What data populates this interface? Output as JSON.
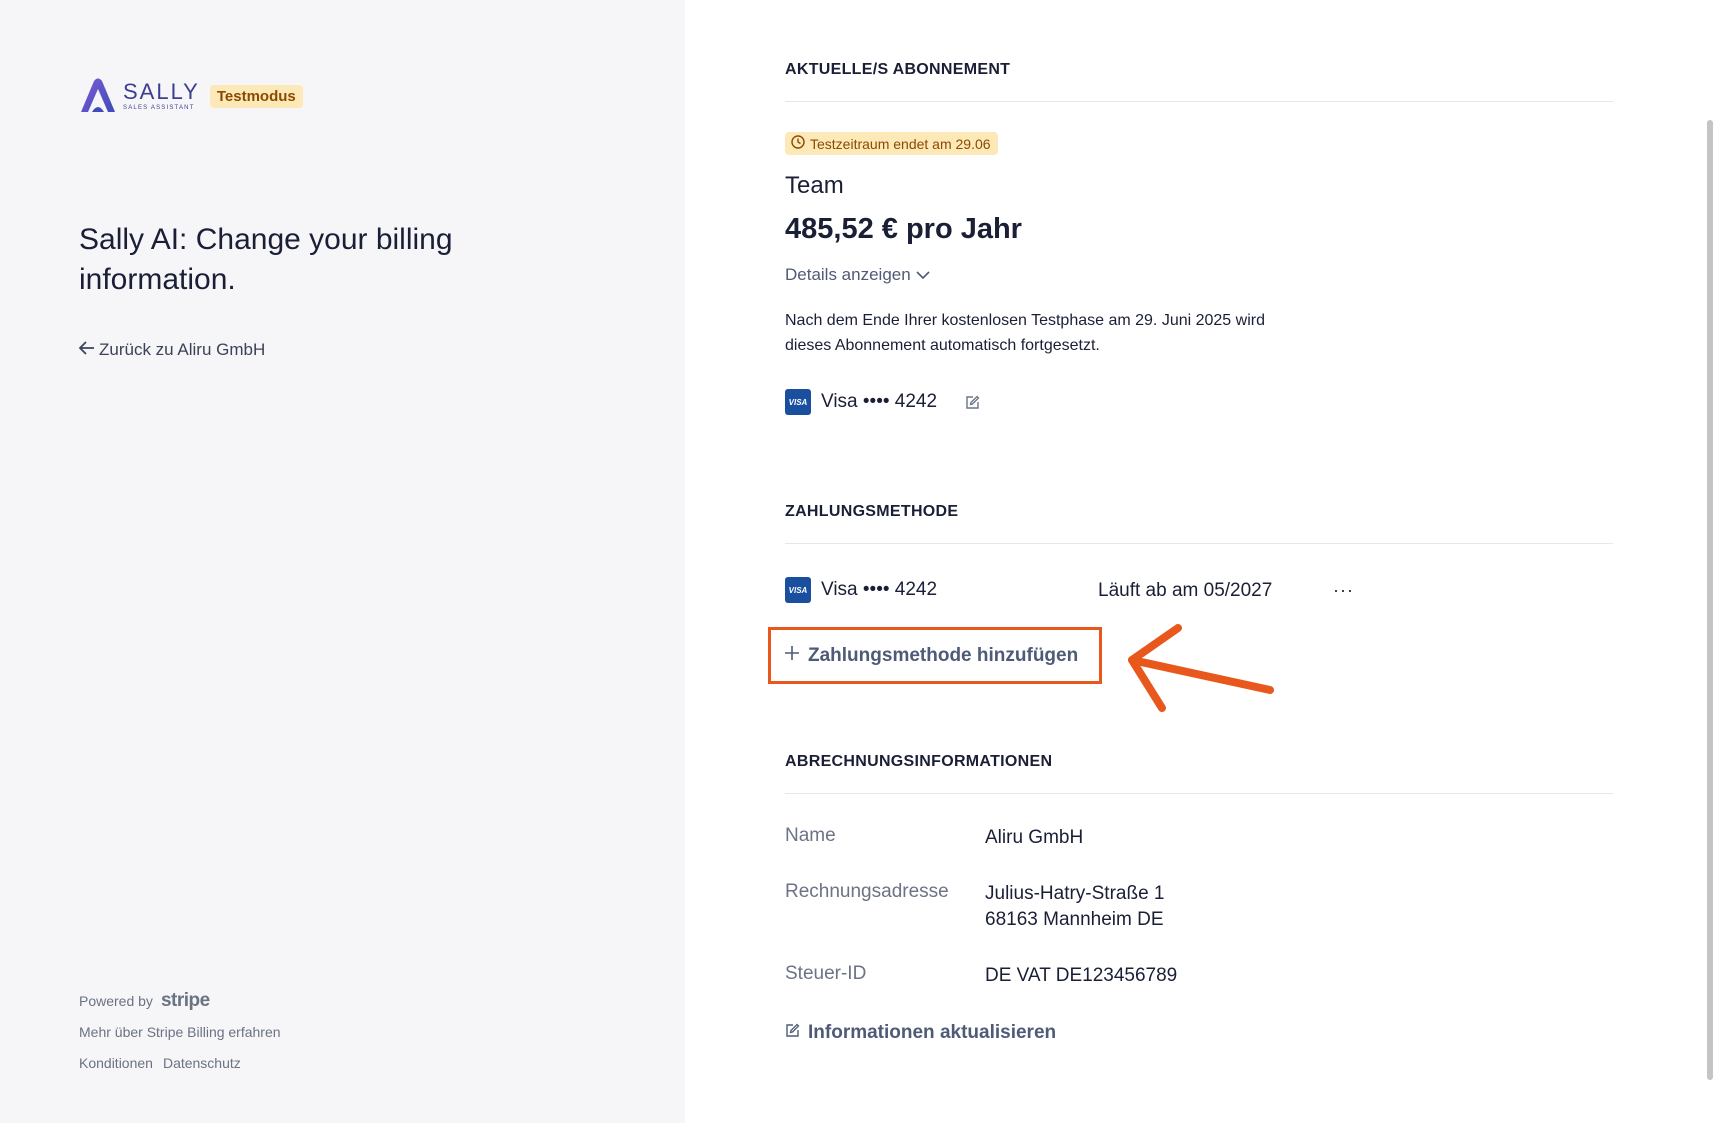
{
  "sidebar": {
    "brand_name": "SALLY",
    "brand_tagline": "SALES ASSISTANT",
    "mode_badge": "Testmodus",
    "headline": "Sally AI: Change your billing information.",
    "back_link": "Zurück zu Aliru GmbH",
    "powered_by": "Powered by",
    "stripe_word": "stripe",
    "learn_more": "Mehr über Stripe Billing erfahren",
    "terms": "Konditionen",
    "privacy": "Datenschutz"
  },
  "subscription": {
    "section_title": "AKTUELLE/S ABONNEMENT",
    "trial_badge": "Testzeitraum endet am 29.06",
    "plan_name": "Team",
    "price": "485,52 € pro Jahr",
    "details_toggle": "Details anzeigen",
    "renew_note": "Nach dem Ende Ihrer kostenlosen Testphase am 29. Juni 2025 wird dieses Abonnement automatisch fortgesetzt.",
    "card_brand_mark": "VISA",
    "card_label": "Visa •••• 4242"
  },
  "payment_method": {
    "section_title": "ZAHLUNGSMETHODE",
    "card_brand_mark": "VISA",
    "card_label": "Visa •••• 4242",
    "expiry": "Läuft ab am 05/2027",
    "more": "···",
    "add_label": "Zahlungsmethode hinzufügen"
  },
  "billing_info": {
    "section_title": "ABRECHNUNGSINFORMATIONEN",
    "name_label": "Name",
    "name_value": "Aliru GmbH",
    "address_label": "Rechnungsadresse",
    "address_line1": "Julius-Hatry-Straße 1",
    "address_line2": "68163 Mannheim DE",
    "tax_label": "Steuer-ID",
    "tax_value": "DE VAT DE123456789",
    "update_link": "Informationen aktualisieren"
  },
  "colors": {
    "accent_annotation": "#e8581c",
    "badge_bg": "#fde8b8",
    "badge_text": "#8a4b00",
    "visa_blue": "#1a4fa0"
  },
  "icons": [
    "sally-logo-icon",
    "arrow-left-icon",
    "clock-icon",
    "chevron-down-icon",
    "edit-icon",
    "plus-icon",
    "annotation-arrow-icon"
  ]
}
